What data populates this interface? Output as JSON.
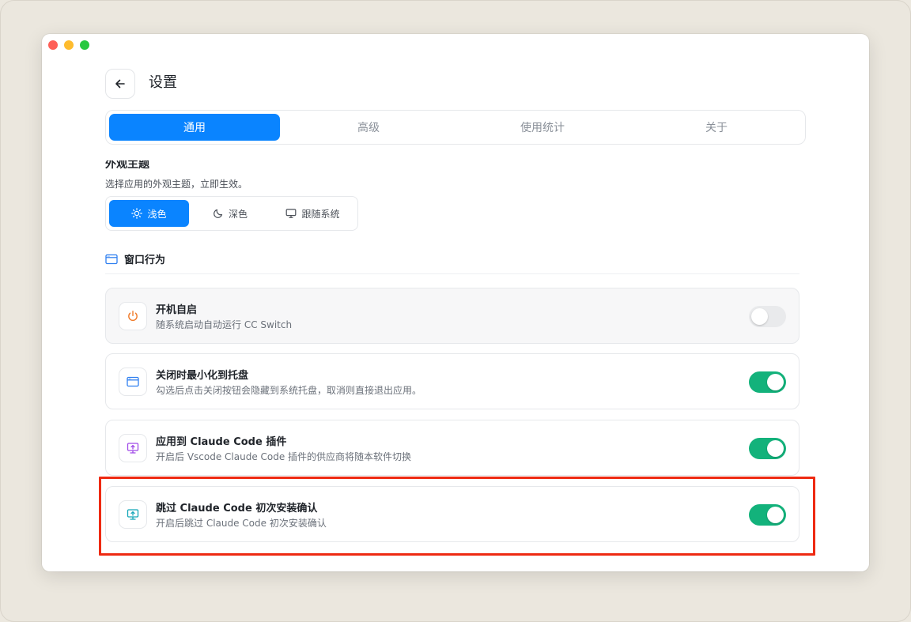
{
  "window": {
    "title": "设置"
  },
  "tabs": [
    {
      "label": "通用",
      "active": true
    },
    {
      "label": "高级",
      "active": false
    },
    {
      "label": "使用统计",
      "active": false
    },
    {
      "label": "关于",
      "active": false
    }
  ],
  "appearance": {
    "title": "外观主题",
    "description": "选择应用的外观主题，立即生效。",
    "options": [
      {
        "label": "浅色",
        "icon": "sun-icon",
        "selected": true
      },
      {
        "label": "深色",
        "icon": "moon-icon",
        "selected": false
      },
      {
        "label": "跟随系统",
        "icon": "monitor-icon",
        "selected": false
      }
    ]
  },
  "window_behavior": {
    "title": "窗口行为",
    "settings": [
      {
        "title": "开机自启",
        "description": "随系统启动自动运行 CC Switch",
        "icon": "power-icon",
        "icon_color": "#f07c2c",
        "enabled": false
      },
      {
        "title": "关闭时最小化到托盘",
        "description": "勾选后点击关闭按钮会隐藏到系统托盘，取消则直接退出应用。",
        "icon": "window-icon",
        "icon_color": "#2f7ff0",
        "enabled": true
      },
      {
        "title": "应用到 Claude Code 插件",
        "description": "开启后 Vscode Claude Code 插件的供应商将随本软件切换",
        "icon": "presentation-icon",
        "icon_color": "#a04ae8",
        "enabled": true
      },
      {
        "title": "跳过 Claude Code 初次安装确认",
        "description": "开启后跳过 Claude Code 初次安装确认",
        "icon": "presentation-icon",
        "icon_color": "#13a6b8",
        "enabled": true
      }
    ]
  },
  "colors": {
    "accent": "#0a84ff",
    "toggle_on": "#13b27b",
    "highlight": "#ee2a12"
  }
}
